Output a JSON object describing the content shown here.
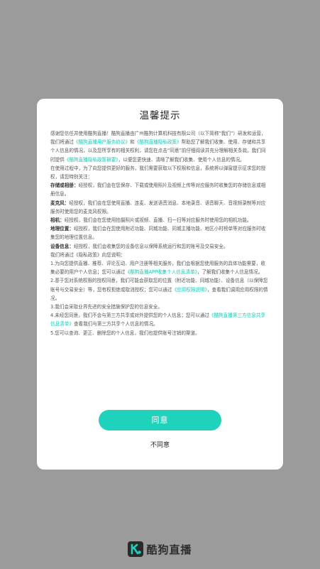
{
  "dialog": {
    "title": "温馨提示",
    "paragraphs": [
      "感谢您信任并使用酷狗直播！酷狗直播由广州酷狗计算机科技有限公司（以下简称“我们”）研发和运营，我们将通过《酷狗直播用户服务协议》和《酷狗直播隐私政策》帮助您了解我们收集、使用、存储和共享个人信息的情况，以及您所享有的相关权利，请您在点击“同意”前仔细阅读并充分理解相关条款。我们同时提供《酷狗直播隐私政策摘要》，以便您更快速、清晰了解我们收集、使用个人信息的情况。",
      "在使用过程中，为了向您提供更好的服务，我们需要获取以下权限和信息，系统将以弹窗提示征求您的授权，请您特别关注：",
      "存储或相册：经授权，我们会在您保存、下载或使用照片及视频上传等对应服务时收集您的存储信息或相册信息。",
      "麦克风：经授权，我们会在您使用直播、连麦、发送语音消息、本地录音、语音聊天、音视频录制等对应服务时使用您的麦克风权限。",
      "相机：经授权，我们会在您使用拍摄照片或视频、直播、扫一扫等对应服务时使用您的相机功能。",
      "地理位置：经授权，我们会在您使用附近功能、同城功能、同城主播功能、地区小时榜单等对应服务时收集您的地理位置信息。",
      "设备信息：经授权，我们会收集您的设备信息以保障系统运行和您的账号及交易安全。",
      "我们将通过《隐私政策》向您说明：",
      "1.为向您提供直播、推荐、评论互动、用户注册等相关服务，我们会根据您使用服务的具体功能需要，收集必要的用户个人信息；您可以通过《酷狗直播APP收集个人信息清单》，了解我们收集个人信息情况。",
      "2.基于您对系统权限的授权同意，我们可能会获取您的位置（附近功能、同城功能）、设备信息（以保障您账号与交易安全）等，您有权拒绝或取消授权；您可以通过《应用权限说明》，查看我们调用应用权限的情况。",
      "3.我们会采取业界先进的安全措施保护您的信息安全。",
      "4.未经您同意，我们不会与第三方共享或对外提供您的个人信息；您可以通过《酷狗直播第三方信息共享信息清单》查看我们与第三方共享个人信息的情况。",
      "5.您可以查询、更正、删除您的个人信息，我们也提供账号注销的渠道。"
    ],
    "links": {
      "user_agreement": "《酷狗直播用户服务协议》",
      "privacy_policy": "《酷狗直播隐私政策》",
      "privacy_summary": "《酷狗直播隐私政策摘要》",
      "collection_list": "《酷狗直播APP收集个人信息清单》",
      "permission_desc": "《应用权限说明》",
      "third_party_list": "《酷狗直播第三方信息共享信息清单》"
    },
    "agree_label": "同意",
    "disagree_label": "不同意"
  },
  "brand": {
    "name": "酷狗直播",
    "icon": "kugou-live-logo-icon",
    "accent": "#1ed2bc"
  }
}
